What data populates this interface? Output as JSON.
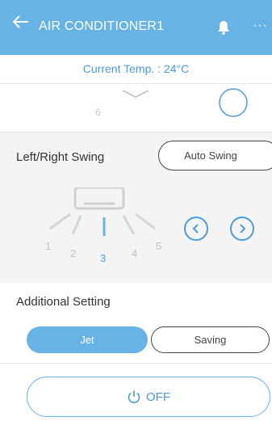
{
  "header": {
    "title": "AIR CONDITIONER1",
    "icons": [
      "back-arrow-icon",
      "bell-icon",
      "more-icon"
    ],
    "more_glyph": "···"
  },
  "status": {
    "current_temp": "Current Temp. : 24°C"
  },
  "upper_card": {
    "visible_number": "6"
  },
  "swing": {
    "label": "Left/Right Swing",
    "mode_button": "Auto Swing",
    "positions": [
      "1",
      "2",
      "3",
      "4",
      "5"
    ],
    "selected_position": "3"
  },
  "additional": {
    "label": "Additional Setting",
    "options": [
      "Jet",
      "Saving"
    ],
    "selected": "Jet"
  },
  "power": {
    "label": "OFF"
  },
  "colors": {
    "accent": "#67b3e6",
    "accent_text": "#4a9bdc",
    "section_bg": "#f4f4f4"
  }
}
